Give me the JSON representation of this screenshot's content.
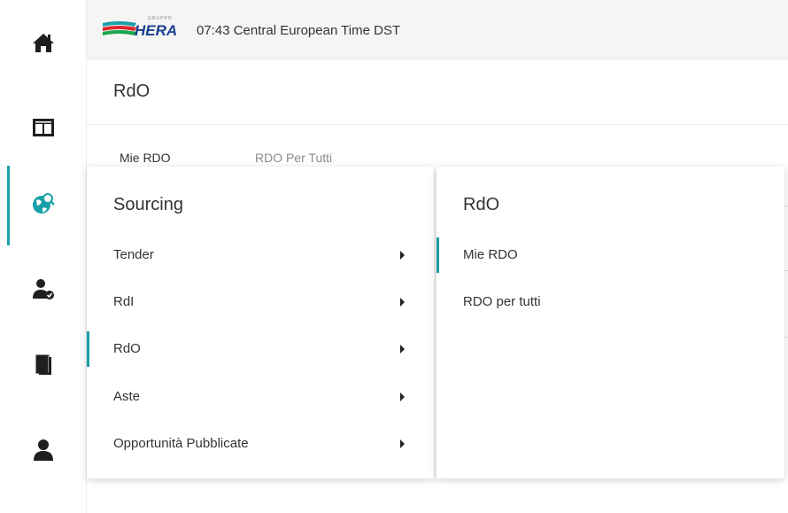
{
  "header": {
    "logo_top_text": "GRUPPO",
    "logo_text": "HERA",
    "clock": "07:43 Central European Time DST"
  },
  "page": {
    "title": "RdO",
    "tabs": [
      "Mie RDO",
      "RDO Per Tutti"
    ]
  },
  "sidebar": {
    "icons": [
      "home-icon",
      "dashboard-icon",
      "sourcing-globe-icon",
      "user-check-icon",
      "documents-icon",
      "profile-icon"
    ],
    "active_index": 2
  },
  "menu": {
    "sourcing": {
      "heading": "Sourcing",
      "items": [
        {
          "label": "Tender"
        },
        {
          "label": "RdI"
        },
        {
          "label": "RdO",
          "active": true
        },
        {
          "label": "Aste"
        },
        {
          "label": "Opportunità Pubblicate"
        }
      ]
    },
    "rdo": {
      "heading": "RdO",
      "items": [
        {
          "label": "Mie RDO",
          "active": true
        },
        {
          "label": "RDO per tutti"
        }
      ]
    }
  },
  "colors": {
    "accent": "#1aa0a8",
    "logo_blue": "#1a3f8f",
    "logo_red": "#e1262d",
    "logo_green": "#1aa64b"
  }
}
